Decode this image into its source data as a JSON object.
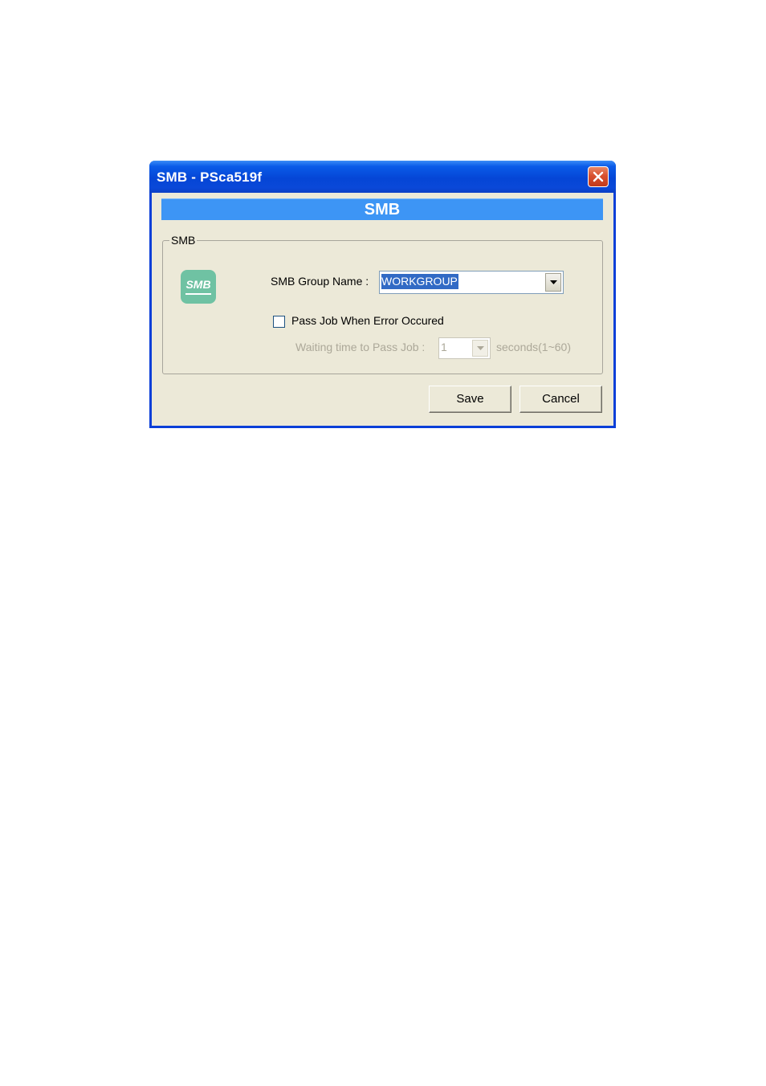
{
  "window": {
    "title": "SMB - PSca519f"
  },
  "banner": {
    "title": "SMB"
  },
  "group": {
    "legend": "SMB",
    "logo_text": "SMB",
    "group_name_label": "SMB Group Name :",
    "group_name_value": "WORKGROUP",
    "pass_job_label": "Pass Job When Error Occured",
    "pass_job_checked": false,
    "waiting_label": "Waiting time to Pass Job :",
    "waiting_value": "1",
    "waiting_unit": "seconds(1~60)"
  },
  "buttons": {
    "save_label": "Save",
    "cancel_label": "Cancel"
  },
  "colors": {
    "titlebar": "#0546d6",
    "banner": "#3d95f5",
    "dialog_bg": "#ece9d8",
    "logo": "#6fc2a3",
    "selection": "#316ac5"
  },
  "icons": {
    "close": "close-icon",
    "dropdown": "chevron-down-icon",
    "logo": "smb-logo-icon"
  }
}
